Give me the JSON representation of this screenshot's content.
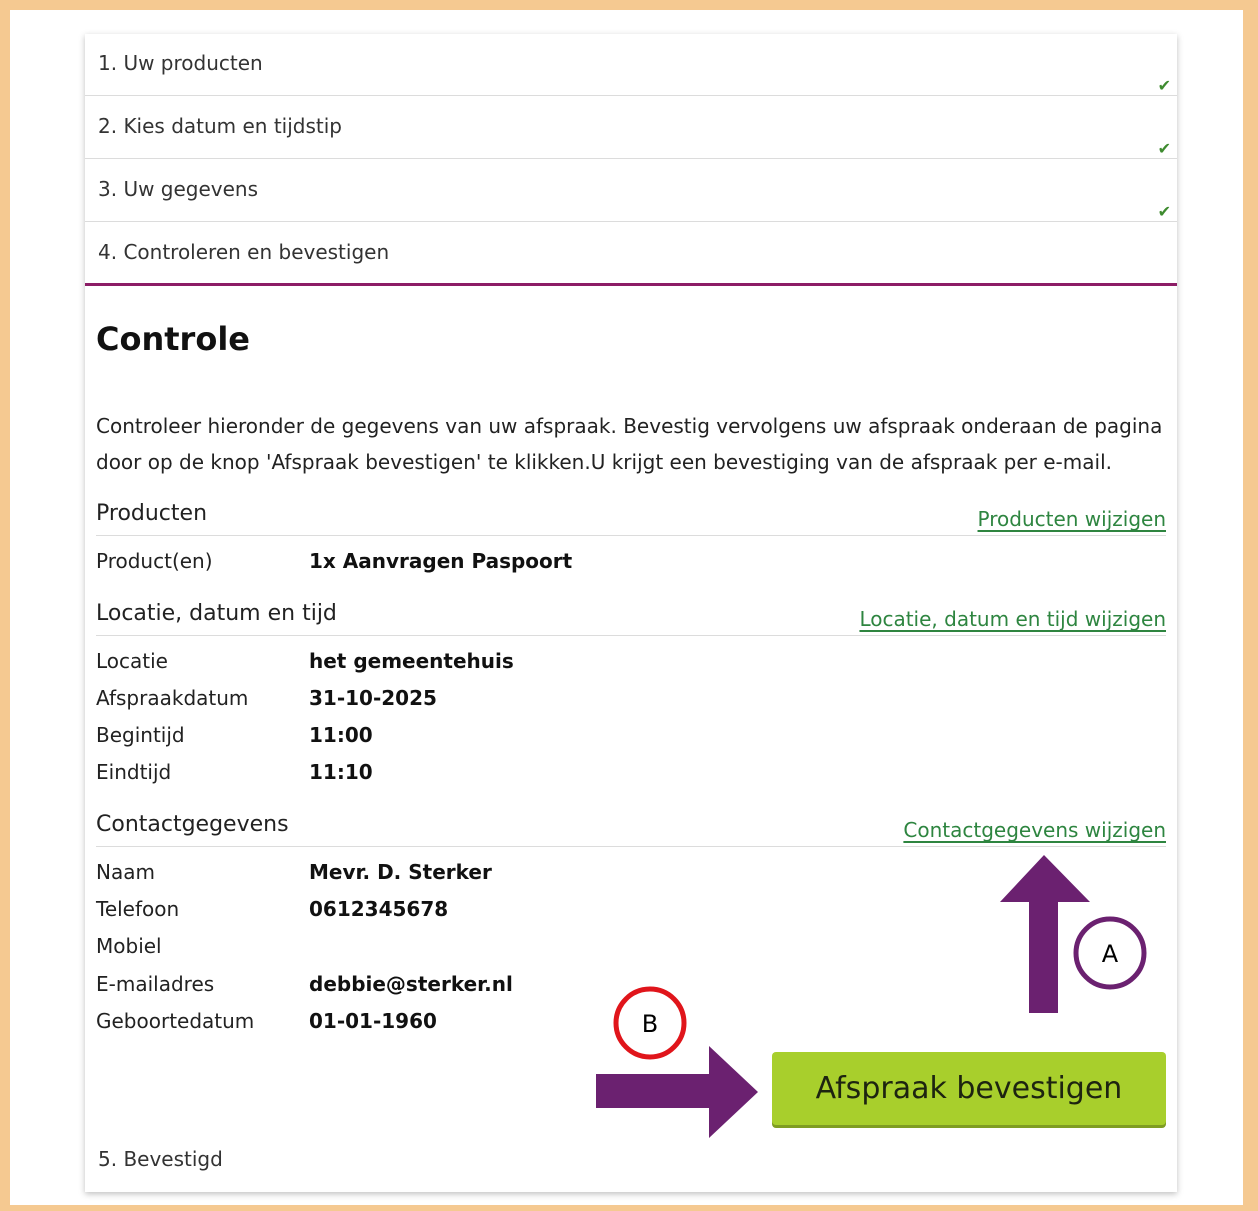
{
  "steps": [
    {
      "label": "1. Uw producten",
      "done": true
    },
    {
      "label": "2. Kies datum en tijdstip",
      "done": true
    },
    {
      "label": "3. Uw gegevens",
      "done": true
    },
    {
      "label": "4. Controleren en bevestigen",
      "done": false
    }
  ],
  "check_glyph": "✔",
  "page_title": "Controle",
  "intro": "Controleer hieronder de gegevens van uw afspraak. Bevestig vervolgens uw afspraak onderaan de pagina door op de knop 'Afspraak bevestigen' te klikken.U krijgt een bevestiging van de afspraak per e-mail.",
  "sections": {
    "products": {
      "title": "Producten",
      "edit_link": "Producten wijzigen",
      "rows": [
        {
          "label": "Product(en)",
          "value": "1x Aanvragen Paspoort"
        }
      ]
    },
    "location": {
      "title": "Locatie, datum en tijd",
      "edit_link": "Locatie, datum en tijd wijzigen",
      "rows": [
        {
          "label": "Locatie",
          "value": "het gemeentehuis"
        },
        {
          "label": "Afspraakdatum",
          "value": "31-10-2025"
        },
        {
          "label": "Begintijd",
          "value": "11:00"
        },
        {
          "label": "Eindtijd",
          "value": "11:10"
        }
      ]
    },
    "contact": {
      "title": "Contactgegevens",
      "edit_link": "Contactgegevens wijzigen",
      "rows": [
        {
          "label": "Naam",
          "value": "Mevr. D. Sterker"
        },
        {
          "label": "Telefoon",
          "value": "0612345678"
        },
        {
          "label": "Mobiel",
          "value": ""
        },
        {
          "label": "E-mailadres",
          "value": "debbie@sterker.nl"
        },
        {
          "label": "Geboortedatum",
          "value": "01-01-1960"
        }
      ]
    }
  },
  "confirm_button": "Afspraak bevestigen",
  "final_step": "5. Bevestigd",
  "annotations": {
    "marker_a": "A",
    "marker_b": "B",
    "arrow_color": "#6b2170",
    "marker_a_color": "#6b2170",
    "marker_b_color": "#e0151b"
  },
  "colors": {
    "frame": "#f5c991",
    "accent": "#8c1d66",
    "link": "#2e8540",
    "button": "#a8cf2c",
    "check": "#3e8b2f"
  }
}
